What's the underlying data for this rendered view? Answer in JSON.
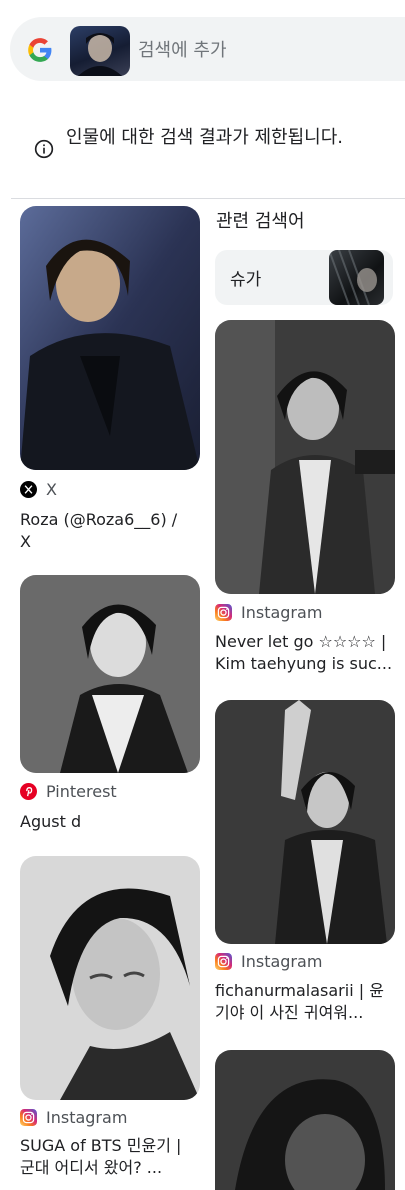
{
  "search": {
    "placeholder": "검색에 추가"
  },
  "notice": {
    "text": "인물에 대한 검색 결과가 제한됩니다."
  },
  "related": {
    "label": "관련 검색어",
    "chip_label": "슈가"
  },
  "results": [
    {
      "source": "X",
      "source_icon": "x-icon",
      "title": "Roza (@Roza6__6) /\nX"
    },
    {
      "source": "Pinterest",
      "source_icon": "pinterest-icon",
      "title": "Agust d"
    },
    {
      "source": "Instagram",
      "source_icon": "instagram-icon",
      "title": "SUGA of BTS 민윤기 |\n군대 어디서 왔어? ..."
    },
    {
      "source": "Instagram",
      "source_icon": "instagram-icon",
      "title": "Never let go ☆☆☆☆ |\nKim taehyung is suc..."
    },
    {
      "source": "Instagram",
      "source_icon": "instagram-icon",
      "title": "fichanurmalasarii | 윤\n기야 이 사진 귀여워..."
    }
  ],
  "colors": {
    "pinterest": "#e60023",
    "instagram_gradient": [
      "#feda75",
      "#fa7e1e",
      "#d62976",
      "#962fbf",
      "#4f5bd5"
    ],
    "search_bg": "#f1f3f4"
  }
}
